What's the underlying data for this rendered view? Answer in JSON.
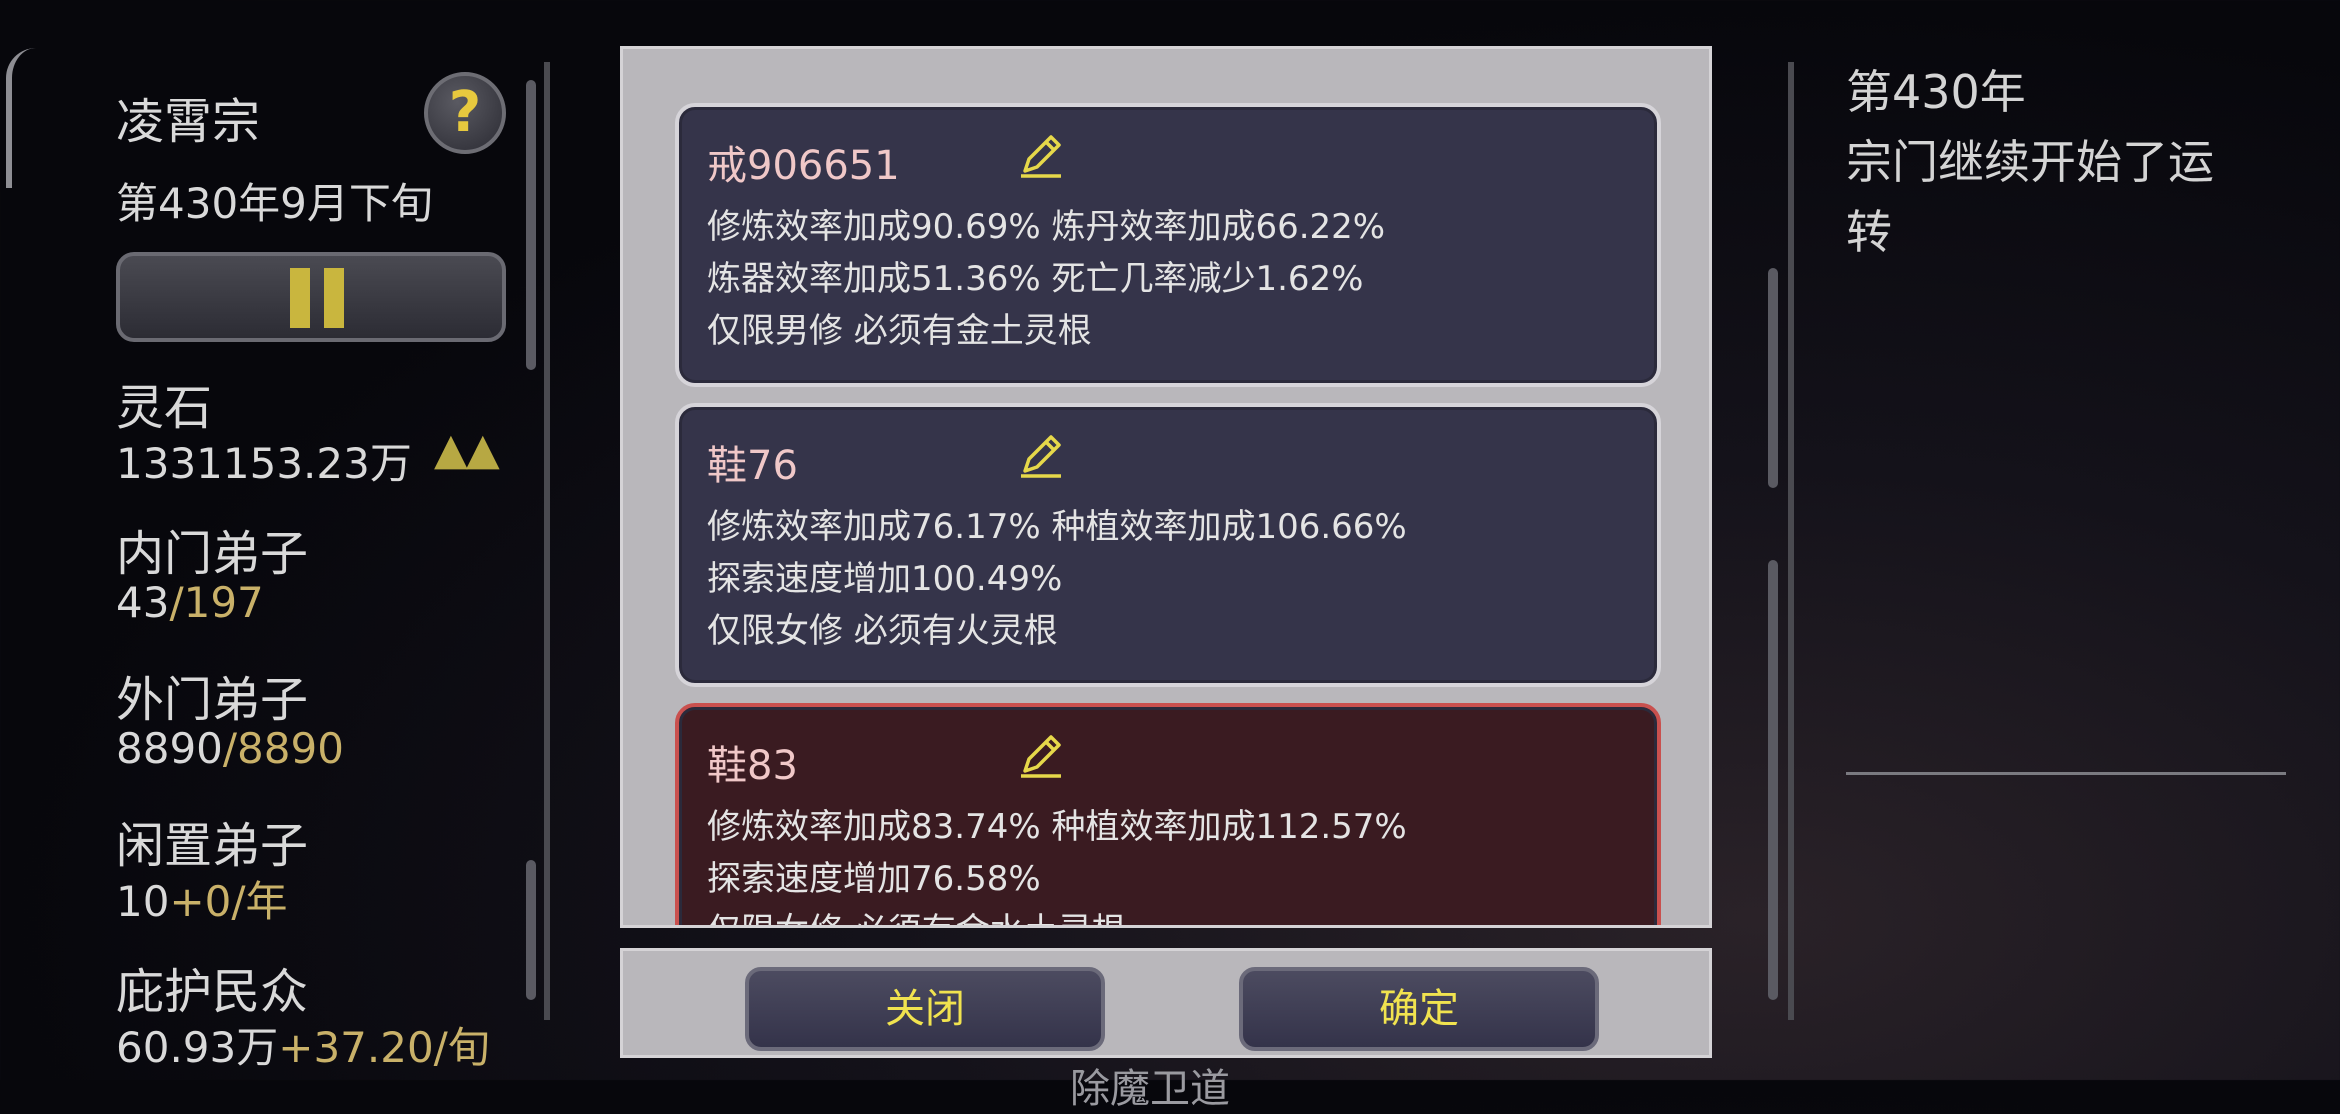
{
  "sect": {
    "name": "凌霄宗",
    "date": "第430年9月下旬"
  },
  "stats": [
    {
      "label": "灵石",
      "value": "1331153.23万",
      "suffix": "",
      "arrows": "▲▲"
    },
    {
      "label": "内门弟子",
      "value": "43",
      "suffix": "/197"
    },
    {
      "label": "外门弟子",
      "value": "8890",
      "suffix": "/8890"
    },
    {
      "label": "闲置弟子",
      "value": "10",
      "suffix": "+0/年"
    },
    {
      "label": "庇护民众",
      "value": "60.93万",
      "suffix": "+37.20/旬"
    }
  ],
  "dialog": {
    "cards": [
      {
        "name": "戒906651",
        "lines": [
          "修炼效率加成90.69% 炼丹效率加成66.22%",
          "炼器效率加成51.36% 死亡几率减少1.62%",
          "仅限男修 必须有金土灵根"
        ],
        "selected": false
      },
      {
        "name": "鞋76",
        "lines": [
          "修炼效率加成76.17% 种植效率加成106.66%",
          "探索速度增加100.49%",
          "仅限女修 必须有火灵根"
        ],
        "selected": false
      },
      {
        "name": "鞋83",
        "lines": [
          "修炼效率加成83.74% 种植效率加成112.57%",
          "探索速度增加76.58%",
          "仅限女修 必须有金水土灵根"
        ],
        "selected": true
      }
    ],
    "close_label": "关闭",
    "confirm_label": "确定"
  },
  "log": {
    "year": "第430年",
    "message_line1": "宗门继续开始了运",
    "message_line2": "转"
  },
  "behind": {
    "bottom_label": "除魔卫道"
  },
  "colors": {
    "gold": "#c9b169",
    "button_text": "#f1e34f",
    "selected_border": "#c9504e"
  }
}
